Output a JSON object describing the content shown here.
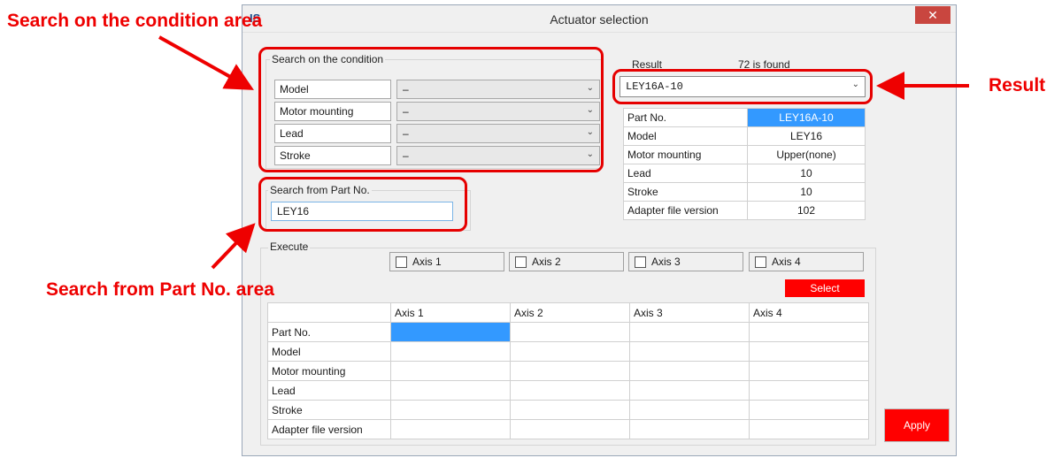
{
  "window": {
    "title": "Actuator selection",
    "close_glyph": "✕",
    "app_icon": "IS"
  },
  "condition": {
    "group_label": "Search on the condition",
    "rows": [
      {
        "label": "Model",
        "value": "–"
      },
      {
        "label": "Motor mounting",
        "value": "–"
      },
      {
        "label": "Lead",
        "value": "–"
      },
      {
        "label": "Stroke",
        "value": "–"
      }
    ]
  },
  "part_search": {
    "group_label": "Search from Part No.",
    "value": "LEY16"
  },
  "result": {
    "label": "Result",
    "count_text": "72 is found",
    "selected": "LEY16A-10",
    "table": [
      {
        "key": "Part No.",
        "value": "LEY16A-10"
      },
      {
        "key": "Model",
        "value": "LEY16"
      },
      {
        "key": "Motor mounting",
        "value": "Upper(none)"
      },
      {
        "key": "Lead",
        "value": "10"
      },
      {
        "key": "Stroke",
        "value": "10"
      },
      {
        "key": "Adapter file version",
        "value": "102"
      }
    ]
  },
  "execute": {
    "group_label": "Execute",
    "axes": [
      "Axis 1",
      "Axis 2",
      "Axis 3",
      "Axis 4"
    ],
    "select_label": "Select"
  },
  "grid": {
    "columns": [
      "Axis 1",
      "Axis 2",
      "Axis 3",
      "Axis 4"
    ],
    "rows": [
      "Part No.",
      "Model",
      "Motor mounting",
      "Lead",
      "Stroke",
      "Adapter file version"
    ]
  },
  "apply_label": "Apply",
  "annotations": {
    "condition_area": "Search on the condition area",
    "part_area": "Search from Part No. area",
    "result": "Result"
  },
  "colors": {
    "accent_red": "#ff0000",
    "annotation_red": "#e60000",
    "highlight_blue": "#3399ff"
  }
}
